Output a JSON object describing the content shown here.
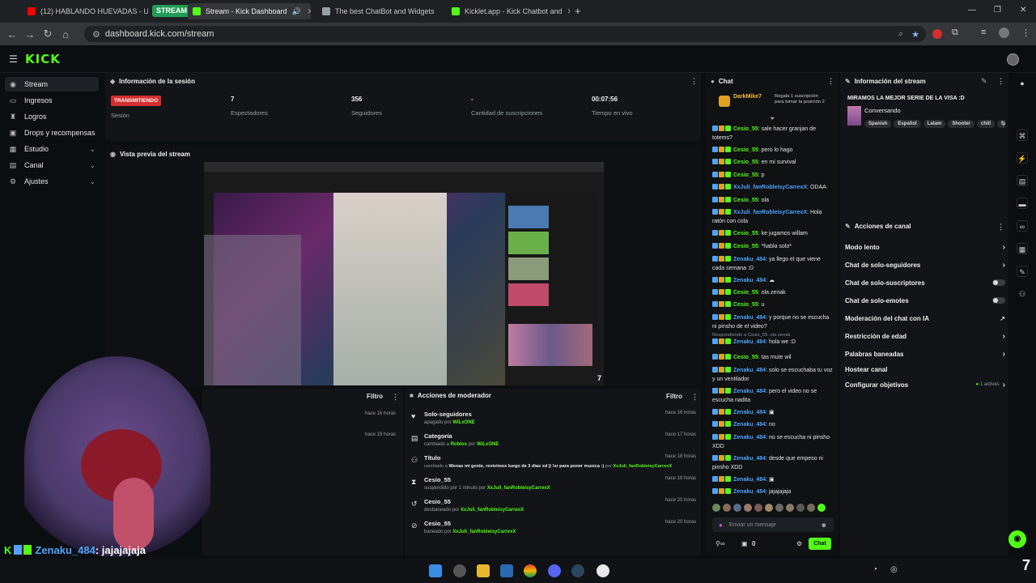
{
  "browser": {
    "tabs": [
      {
        "title": "(12) HABLANDO HUEVADAS - U",
        "fav": "#ff0000"
      },
      {
        "title": "Stream - Kick Dashboard",
        "fav": "#53fc18"
      },
      {
        "title": "The best ChatBot and Widgets",
        "fav": "#9aa0a6"
      },
      {
        "title": "Kicklet.app - Kick Chatbot and",
        "fav": "#53fc18"
      }
    ],
    "tab_group_label": "STREAM",
    "new_tab": "+",
    "url": "dashboard.kick.com/stream"
  },
  "app": {
    "logo": "KICK"
  },
  "sidebar": {
    "items": [
      {
        "label": "Stream",
        "icon": "broadcast-icon"
      },
      {
        "label": "Ingresos",
        "icon": "money-icon"
      },
      {
        "label": "Logros",
        "icon": "trophy-icon"
      },
      {
        "label": "Drops y recompensas",
        "icon": "gift-icon"
      },
      {
        "label": "Estudio",
        "icon": "studio-icon"
      },
      {
        "label": "Canal",
        "icon": "channel-icon"
      },
      {
        "label": "Ajustes",
        "icon": "gear-icon"
      }
    ]
  },
  "session": {
    "title": "Información de la sesión",
    "status": "TRANSMITIENDO",
    "status_label": "Sesión",
    "stats": [
      {
        "value": "7",
        "label": "Espectadores"
      },
      {
        "value": "356",
        "label": "Seguidores"
      },
      {
        "value": "-",
        "label": "Cantidad de suscripciones"
      },
      {
        "value": "00:07:56",
        "label": "Tiempo en vivo"
      }
    ]
  },
  "preview": {
    "title": "Vista previa del stream"
  },
  "filter_panel": {
    "filter": "Filtro",
    "times": [
      "hace 16 horas",
      "hace 19 horas"
    ]
  },
  "mod_actions": {
    "title": "Acciones de moderador",
    "filter": "Filtro",
    "rows": [
      {
        "title": "Solo-seguidores",
        "sub": "apagado por",
        "user": "WiLxONE",
        "time": "hace 16 horas",
        "icon": "heart-icon"
      },
      {
        "title": "Categoría",
        "sub": "cambiado a",
        "extra": "Roblox",
        "sub2": "por",
        "user": "WiLxONE",
        "time": "hace 17 horas",
        "icon": "category-icon"
      },
      {
        "title": "Título",
        "sub": "cambiado a",
        "extra": "Wenas mi gente, revivimos luego de 3 dias xd || !sr para poner musica :)",
        "sub2": "por",
        "user": "XxJuli_fanRobleisyCarrexX",
        "time": "hace 18 horas",
        "icon": "title-icon"
      },
      {
        "title": "Cesio_55",
        "sub": "suspendido por 1 minuto por",
        "user": "XxJuli_fanRobleisyCarrexX",
        "time": "hace 18 horas",
        "icon": "hourglass-icon"
      },
      {
        "title": "Cesio_55",
        "sub": "desbaneado por",
        "user": "XxJuli_fanRobleisyCarrexX",
        "time": "hace 20 horas",
        "icon": "undo-icon"
      },
      {
        "title": "Cesio_55",
        "sub": "baneado por",
        "user": "XxJuli_fanRobleisyCarrexX",
        "time": "hace 20 horas",
        "icon": "ban-icon"
      }
    ]
  },
  "chat": {
    "title": "Chat",
    "pinned_user": "DarkMike7",
    "pinned_text": "Regala 1 suscripción para tomar la posición 2",
    "messages": [
      {
        "user": "Cesio_55",
        "color": "gold",
        "text": "sale hacer granjan de totems?"
      },
      {
        "user": "Cesio_55",
        "color": "gold",
        "text": "pero lo hago"
      },
      {
        "user": "Cesio_55",
        "color": "gold",
        "text": "en mi survival"
      },
      {
        "user": "Cesio_55",
        "color": "gold",
        "text": "p"
      },
      {
        "user": "XxJuli_fanRobleisyCarrexX",
        "color": "blue",
        "text": "ODAA"
      },
      {
        "user": "Cesio_55",
        "color": "gold",
        "text": "ola"
      },
      {
        "user": "XxJuli_fanRobleisyCarrexX",
        "color": "blue",
        "text": "Hola ratón con cola"
      },
      {
        "user": "Cesio_55",
        "color": "gold",
        "text": "ke jugamos willam"
      },
      {
        "user": "Cesio_55",
        "color": "gold",
        "text": "*habla solo*"
      },
      {
        "user": "Zenaku_484",
        "color": "blue",
        "text": "ya llego el que viene cada semana :D"
      },
      {
        "user": "Zenaku_484",
        "color": "blue",
        "text": "☁"
      },
      {
        "user": "Cesio_55",
        "color": "gold",
        "text": "ola zenak"
      },
      {
        "user": "Cesio_55",
        "color": "gold",
        "text": "u"
      },
      {
        "user": "Zenaku_484",
        "color": "blue",
        "text": "y porque no se escucha ni pinsho de el video?"
      },
      {
        "user": "Zenaku_484",
        "color": "blue",
        "text": "hola we :D",
        "reply": "Respondiendo a Cesio_55: ola zenak"
      },
      {
        "user": "Cesio_55",
        "color": "gold",
        "text": "tas mute wil"
      },
      {
        "user": "Zenaku_484",
        "color": "blue",
        "text": "solo se escuchaba tu voz y un ventilador"
      },
      {
        "user": "Zenaku_484",
        "color": "blue",
        "text": "pero el video no se escucha nadita"
      },
      {
        "user": "Zenaku_484",
        "color": "blue",
        "text": "▣"
      },
      {
        "user": "Zenaku_484",
        "color": "blue",
        "text": "no"
      },
      {
        "user": "Zenaku_484",
        "color": "blue",
        "text": "no se escucha ni pinsho XDD"
      },
      {
        "user": "Zenaku_484",
        "color": "blue",
        "text": "desde que empeso ni pinsho XDD"
      },
      {
        "user": "Zenaku_484",
        "color": "blue",
        "text": "▣"
      },
      {
        "user": "Zenaku_484",
        "color": "blue",
        "text": "jajajajaja"
      }
    ],
    "input_placeholder": "Enviar un mensaje",
    "count": "0",
    "send_label": "Chat"
  },
  "stream_info": {
    "title": "Información del stream",
    "stream_title": "MIRAMOS LA MEJOR SERIE DE LA VISA :D",
    "category": "Conversando",
    "tags": [
      "Spanish",
      "Español",
      "Latam",
      "Shooter",
      "chill",
      "fps"
    ]
  },
  "channel_actions": {
    "title": "Acciones de canal",
    "rows": [
      {
        "label": "Modo lento",
        "kind": "chevron"
      },
      {
        "label": "Chat de solo-seguidores",
        "kind": "chevron"
      },
      {
        "label": "Chat de solo-suscriptores",
        "kind": "toggle"
      },
      {
        "label": "Chat de solo-emotes",
        "kind": "toggle"
      },
      {
        "label": "Moderación del chat con IA",
        "kind": "external"
      },
      {
        "label": "Restricción de edad",
        "kind": "chevron"
      },
      {
        "label": "Palabras baneadas",
        "kind": "chevron"
      },
      {
        "label": "Hostear canal",
        "kind": "none"
      },
      {
        "label": "Configurar objetivos",
        "kind": "chevron",
        "extra": "1 activas"
      }
    ]
  },
  "overlay": {
    "user": "Zenaku_484",
    "text": ": jajajajaja"
  },
  "corner_number": "7"
}
